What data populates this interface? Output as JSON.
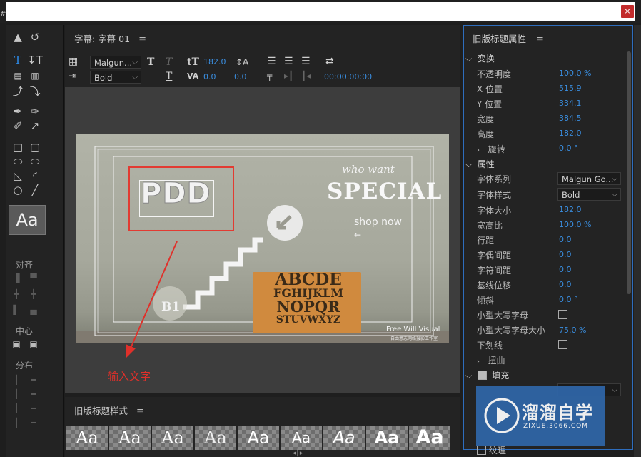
{
  "window": {
    "close_glyph": "×",
    "left_edge_char": "#"
  },
  "tools": {
    "align_label": "对齐",
    "center_label": "中心",
    "distribute_label": "分布",
    "style_swatch": "Aa"
  },
  "editor": {
    "title": "字幕: 字幕 01",
    "font_family": "Malgun...",
    "font_style": "Bold",
    "font_size": "182.0",
    "kerning": "0.0",
    "leading": "0.0",
    "timecode": "00:00:00:00"
  },
  "canvas": {
    "typed_text": "PDD",
    "photo_texts": {
      "who_want": "who  want",
      "special": "SPECIAL",
      "shop_now": "shop now",
      "b1": "B1",
      "letters_rows": [
        "ABCDE",
        "FGHIJKLM",
        "NOPQR",
        "STUVWXYZ"
      ],
      "watermark": "Free Will Visual",
      "watermark_sub": "自由意志网络摄影工作室"
    },
    "annotation": "输入文字"
  },
  "styles_panel": {
    "title": "旧版标题样式",
    "swatches": [
      "Aa",
      "Aa",
      "Aa",
      "Aa",
      "Aa",
      "Aa",
      "Aa",
      "Aa",
      "Aa"
    ]
  },
  "properties": {
    "title": "旧版标题属性",
    "transform": {
      "label": "变换",
      "rows": [
        {
          "label": "不透明度",
          "value": "100.0 %"
        },
        {
          "label": "X 位置",
          "value": "515.9"
        },
        {
          "label": "Y 位置",
          "value": "334.1"
        },
        {
          "label": "宽度",
          "value": "384.5"
        },
        {
          "label": "高度",
          "value": "182.0"
        },
        {
          "label": "旋转",
          "value": "0.0 °"
        }
      ]
    },
    "attributes": {
      "label": "属性",
      "font_family_label": "字体系列",
      "font_family_value": "Malgun Go...",
      "font_style_label": "字体样式",
      "font_style_value": "Bold",
      "rows": [
        {
          "label": "字体大小",
          "value": "182.0"
        },
        {
          "label": "宽高比",
          "value": "100.0 %"
        },
        {
          "label": "行距",
          "value": "0.0"
        },
        {
          "label": "字偶间距",
          "value": "0.0"
        },
        {
          "label": "字符间距",
          "value": "0.0"
        },
        {
          "label": "基线位移",
          "value": "0.0"
        },
        {
          "label": "倾斜",
          "value": "0.0 °"
        }
      ],
      "small_caps_label": "小型大写字母",
      "small_caps_size_label": "小型大写字母大小",
      "small_caps_size_value": "75.0 %",
      "underline_label": "下划线",
      "distort_label": "扭曲"
    },
    "fill": {
      "label": "填充",
      "texture_label": "纹理"
    }
  },
  "watermark": {
    "brand": "溜溜自学",
    "url": "ZIXUE.3066.COM"
  },
  "colors": {
    "accent": "#3a8ee0",
    "panel_border": "#2e6dbd",
    "annotation": "#e0302a",
    "close": "#c22b2b"
  }
}
